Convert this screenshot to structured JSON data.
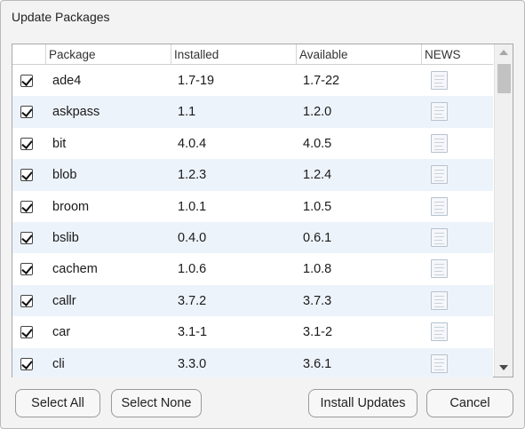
{
  "window": {
    "title": "Update Packages"
  },
  "table": {
    "columns": [
      "Package",
      "Installed",
      "Available",
      "NEWS"
    ],
    "rows": [
      {
        "checked": true,
        "package": "ade4",
        "installed": "1.7-19",
        "available": "1.7-22"
      },
      {
        "checked": true,
        "package": "askpass",
        "installed": "1.1",
        "available": "1.2.0"
      },
      {
        "checked": true,
        "package": "bit",
        "installed": "4.0.4",
        "available": "4.0.5"
      },
      {
        "checked": true,
        "package": "blob",
        "installed": "1.2.3",
        "available": "1.2.4"
      },
      {
        "checked": true,
        "package": "broom",
        "installed": "1.0.1",
        "available": "1.0.5"
      },
      {
        "checked": true,
        "package": "bslib",
        "installed": "0.4.0",
        "available": "0.6.1"
      },
      {
        "checked": true,
        "package": "cachem",
        "installed": "1.0.6",
        "available": "1.0.8"
      },
      {
        "checked": true,
        "package": "callr",
        "installed": "3.7.2",
        "available": "3.7.3"
      },
      {
        "checked": true,
        "package": "car",
        "installed": "3.1-1",
        "available": "3.1-2"
      },
      {
        "checked": true,
        "package": "cli",
        "installed": "3.3.0",
        "available": "3.6.1"
      }
    ],
    "news_icon": "document-icon",
    "row_colors": {
      "alt": "#edf3fb",
      "plain": "#ffffff"
    }
  },
  "buttons": {
    "select_all": "Select All",
    "select_none": "Select None",
    "install_updates": "Install Updates",
    "cancel": "Cancel"
  }
}
